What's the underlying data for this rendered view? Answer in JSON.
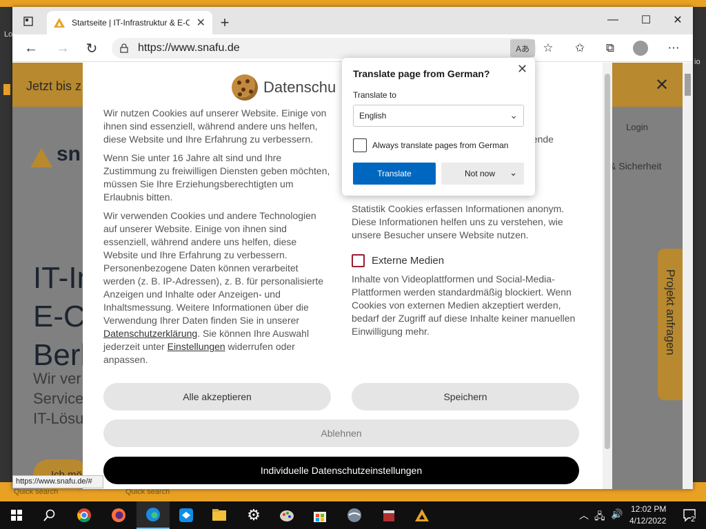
{
  "browser": {
    "tab_title": "Startseite | IT-Infrastruktur & E-Commerce",
    "url": "https://www.snafu.de",
    "status_url": "https://www.snafu.de/#"
  },
  "desktop": {
    "left_label": "Lo",
    "right_label": "io",
    "quick_search_1": "Quick search",
    "quick_search_2": "Quick search"
  },
  "website": {
    "banner_text": "Jetzt bis z",
    "logo_text": "sn",
    "hero_title_lines": [
      "IT-In",
      "E-Co",
      "Berl"
    ],
    "hero_sub_lines": [
      "Wir ver",
      "Service",
      "IT-Lösu"
    ],
    "login": "Login",
    "nav_security": "& Sicherheit",
    "projekt_anfragen": "Projekt anfragen",
    "cta": "Ich mö"
  },
  "cookie_modal": {
    "title": "Datenschu",
    "left_paragraphs": {
      "p1": "Wir nutzen Cookies auf unserer Website. Einige von ihnen sind essenziell, während andere uns helfen, diese Website und Ihre Erfahrung zu verbessern.",
      "p2": "Wenn Sie unter 16 Jahre alt sind und Ihre Zustimmung zu freiwilligen Diensten geben möchten, müssen Sie Ihre Erziehungsberechtigten um Erlaubnis bitten.",
      "p3_a": "Wir verwenden Cookies und andere Technologien auf unserer Website. Einige von ihnen sind essenziell, während andere uns helfen, diese Website und Ihre Erfahrung zu verbessern. Personenbezogene Daten können verarbeitet werden (z. B. IP-Adressen), z. B. für personalisierte Anzeigen und Inhalte oder Anzeigen- und Inhaltsmessung. Weitere Informationen über die Verwendung Ihrer Daten finden Sie in unserer ",
      "p3_link1": "Datenschutzerklärung",
      "p3_b": ". Sie können Ihre Auswahl jederzeit unter ",
      "p3_link2": "Einstellungen",
      "p3_c": " widerrufen oder anpassen."
    },
    "partial_right_top": "gende",
    "statistik_desc": "Statistik Cookies erfassen Informationen anonym. Diese Informationen helfen uns zu verstehen, wie unsere Besucher unsere Website nutzen.",
    "externe_label": "Externe Medien",
    "externe_desc": "Inhalte von Videoplattformen und Social-Media-Plattformen werden standardmäßig blockiert. Wenn Cookies von externen Medien akzeptiert werden, bedarf der Zugriff auf diese Inhalte keiner manuellen Einwilligung mehr.",
    "btn_accept_all": "Alle akzeptieren",
    "btn_save": "Speichern",
    "btn_reject": "Ablehnen",
    "btn_individual": "Individuelle Datenschutzeinstellungen"
  },
  "translate_popup": {
    "heading": "Translate page from German?",
    "translate_to_label": "Translate to",
    "selected_language": "English",
    "always_translate": "Always translate pages from German",
    "translate_btn": "Translate",
    "not_now_btn": "Not now"
  },
  "taskbar": {
    "time": "12:02 PM",
    "date": "4/12/2022",
    "notification_count": "2"
  },
  "colors": {
    "accent_orange": "#e9a123",
    "edge_blue": "#0067c0",
    "checkbox_red": "#9b1b2e"
  }
}
